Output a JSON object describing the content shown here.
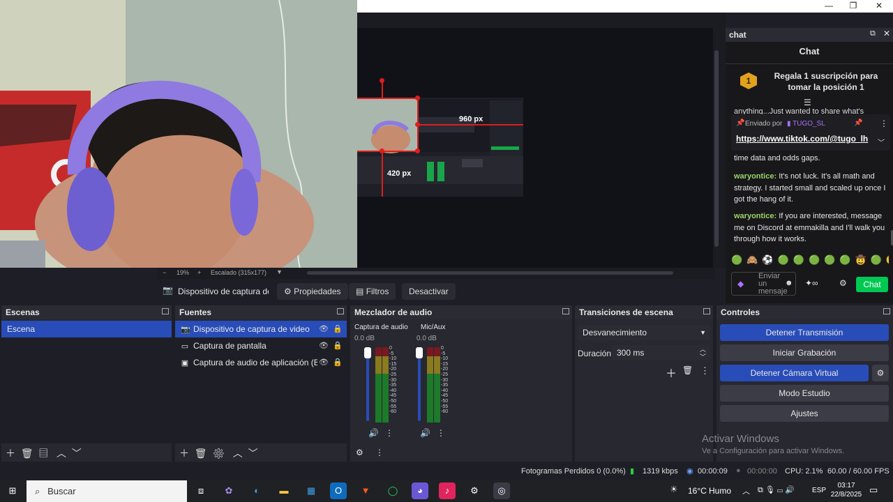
{
  "window": {
    "minimize": "—",
    "maximize": "❐",
    "close": "✕"
  },
  "preview": {
    "nested_width": "960 px",
    "nested_height": "420 px",
    "zoom": "19%",
    "scale": "Escalado (315x177)",
    "zoom_minus": "−",
    "zoom_plus": "+"
  },
  "source_toolbar": {
    "source_name": "Dispositivo de captura de v",
    "properties": "Propiedades",
    "filters": "Filtros",
    "deactivate": "Desactivar"
  },
  "docks": {
    "scenes": {
      "title": "Escenas",
      "items": [
        "Escena"
      ]
    },
    "sources": {
      "title": "Fuentes",
      "items": [
        "Dispositivo de captura de video",
        "Captura de pantalla",
        "Captura de audio de aplicación (BET."
      ]
    },
    "mixer": {
      "title": "Mezclador de audio",
      "channels": [
        {
          "name": "Captura de audio d",
          "db": "0.0 dB"
        },
        {
          "name": "Mic/Aux",
          "db": "0.0 dB"
        }
      ],
      "ticks": [
        "0",
        "-5",
        "-10",
        "-15",
        "-20",
        "-25",
        "-30",
        "-35",
        "-40",
        "-45",
        "-50",
        "-55",
        "-60"
      ]
    },
    "transitions": {
      "title": "Transiciones de escena",
      "selected": "Desvanecimiento",
      "duration_label": "Duración",
      "duration_value": "300 ms"
    },
    "controls": {
      "title": "Controles",
      "buttons": [
        "Detener Transmisión",
        "Iniciar Grabación",
        "Detener Cámara Virtual",
        "Modo Estudio",
        "Ajustes"
      ]
    }
  },
  "chat": {
    "header": "chat",
    "title": "Chat",
    "rank": "1",
    "gift_text": "Regala 1 suscripción para tomar la posición 1",
    "pinned_partial": "anything...Just wanted to share what's",
    "pinned_label": "Enviado por",
    "pinned_user": "TUGO_SL",
    "pinned_link": "https://www.tiktok.com/@tugo_lh",
    "partial_line": "time data and odds gaps.",
    "messages": [
      {
        "user": "waryontice:",
        "text": "It's not luck. It's all math and strategy. I started small and scaled up once I got the hang of it."
      },
      {
        "user": "waryontice:",
        "text": "If you are interested, message me on Discord at emmakilla and I'll walk you through how it works."
      }
    ],
    "emotes": [
      "🟢",
      "🙈",
      "⚽",
      "🟢",
      "🟢",
      "🟢",
      "🟢",
      "🟢",
      "🤠",
      "🟢",
      "😵"
    ],
    "input_placeholder": "Enviar un mensaje",
    "send_label": "Chat",
    "accent": "#00c853"
  },
  "status": {
    "dropped": "Fotogramas Perdidos 0 (0.0%)",
    "bitrate": "1319 kbps",
    "stream_time": "00:00:09",
    "rec_time": "00:00:00",
    "cpu": "CPU: 2.1%",
    "fps": "60.00 / 60.00 FPS"
  },
  "watermark": {
    "line1": "Activar Windows",
    "line2": "Ve a Configuración para activar Windows."
  },
  "taskbar": {
    "search": "Buscar",
    "weather": "16°C",
    "weather_label": "Humo",
    "lang": "ESP",
    "time": "03:17",
    "date": "22/8/2025"
  },
  "colors": {
    "accent_blue": "#284cb8",
    "selection_red": "#e01d1d",
    "chat_green": "#00c853"
  }
}
